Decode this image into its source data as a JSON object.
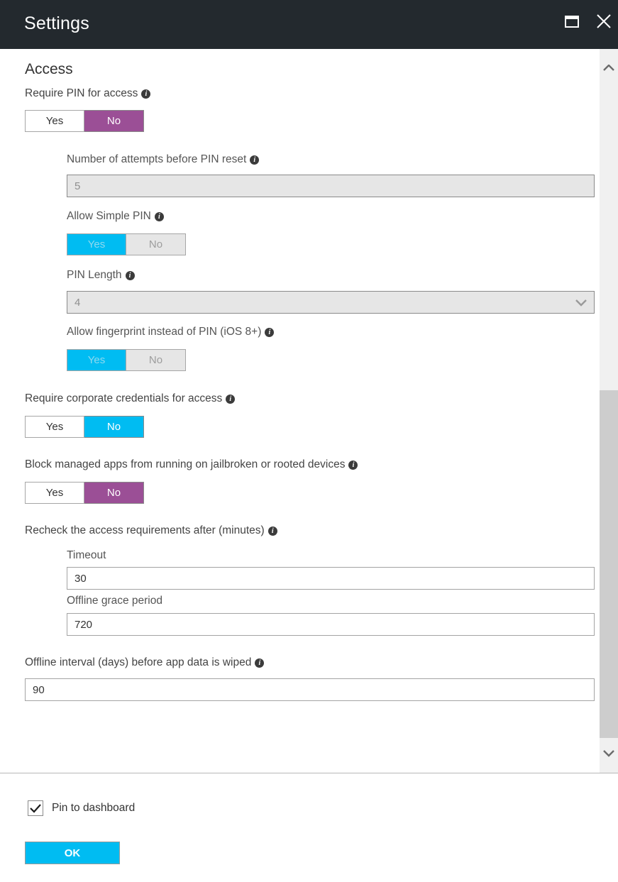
{
  "header": {
    "title": "Settings",
    "restore_icon": "restore-window-icon",
    "close_icon": "close-icon"
  },
  "content": {
    "section_title": "Access",
    "info_glyph": "i",
    "fields": {
      "require_pin": {
        "label": "Require PIN for access",
        "yes": "Yes",
        "no": "No",
        "selected": "No"
      },
      "attempts": {
        "label": "Number of attempts before PIN reset",
        "value": "5"
      },
      "simple_pin": {
        "label": "Allow Simple PIN",
        "yes": "Yes",
        "no": "No",
        "selected": "Yes"
      },
      "pin_length": {
        "label": "PIN Length",
        "value": "4",
        "chevron_icon": "chevron-down-icon"
      },
      "fingerprint": {
        "label": "Allow fingerprint instead of PIN (iOS 8+)",
        "yes": "Yes",
        "no": "No",
        "selected": "Yes"
      },
      "corp_creds": {
        "label": "Require corporate credentials for access",
        "yes": "Yes",
        "no": "No",
        "selected": "No"
      },
      "jailbreak": {
        "label": "Block managed apps from running on jailbroken or rooted devices",
        "yes": "Yes",
        "no": "No",
        "selected": "No"
      },
      "recheck": {
        "label": "Recheck the access requirements after (minutes)",
        "timeout_label": "Timeout",
        "timeout_value": "30",
        "grace_label": "Offline grace period",
        "grace_value": "720"
      },
      "offline_wipe": {
        "label": "Offline interval (days) before app data is wiped",
        "value": "90"
      }
    }
  },
  "scrollbar": {
    "up_icon": "chevron-up-icon",
    "down_icon": "chevron-down-icon"
  },
  "footer": {
    "pin_to_dashboard": "Pin to dashboard",
    "pin_checked": true,
    "ok_label": "OK"
  },
  "colors": {
    "header_bg": "#23292e",
    "accent_blue": "#00bcf2",
    "accent_purple": "#9b4f96",
    "disabled_bg": "#e6e6e6"
  }
}
